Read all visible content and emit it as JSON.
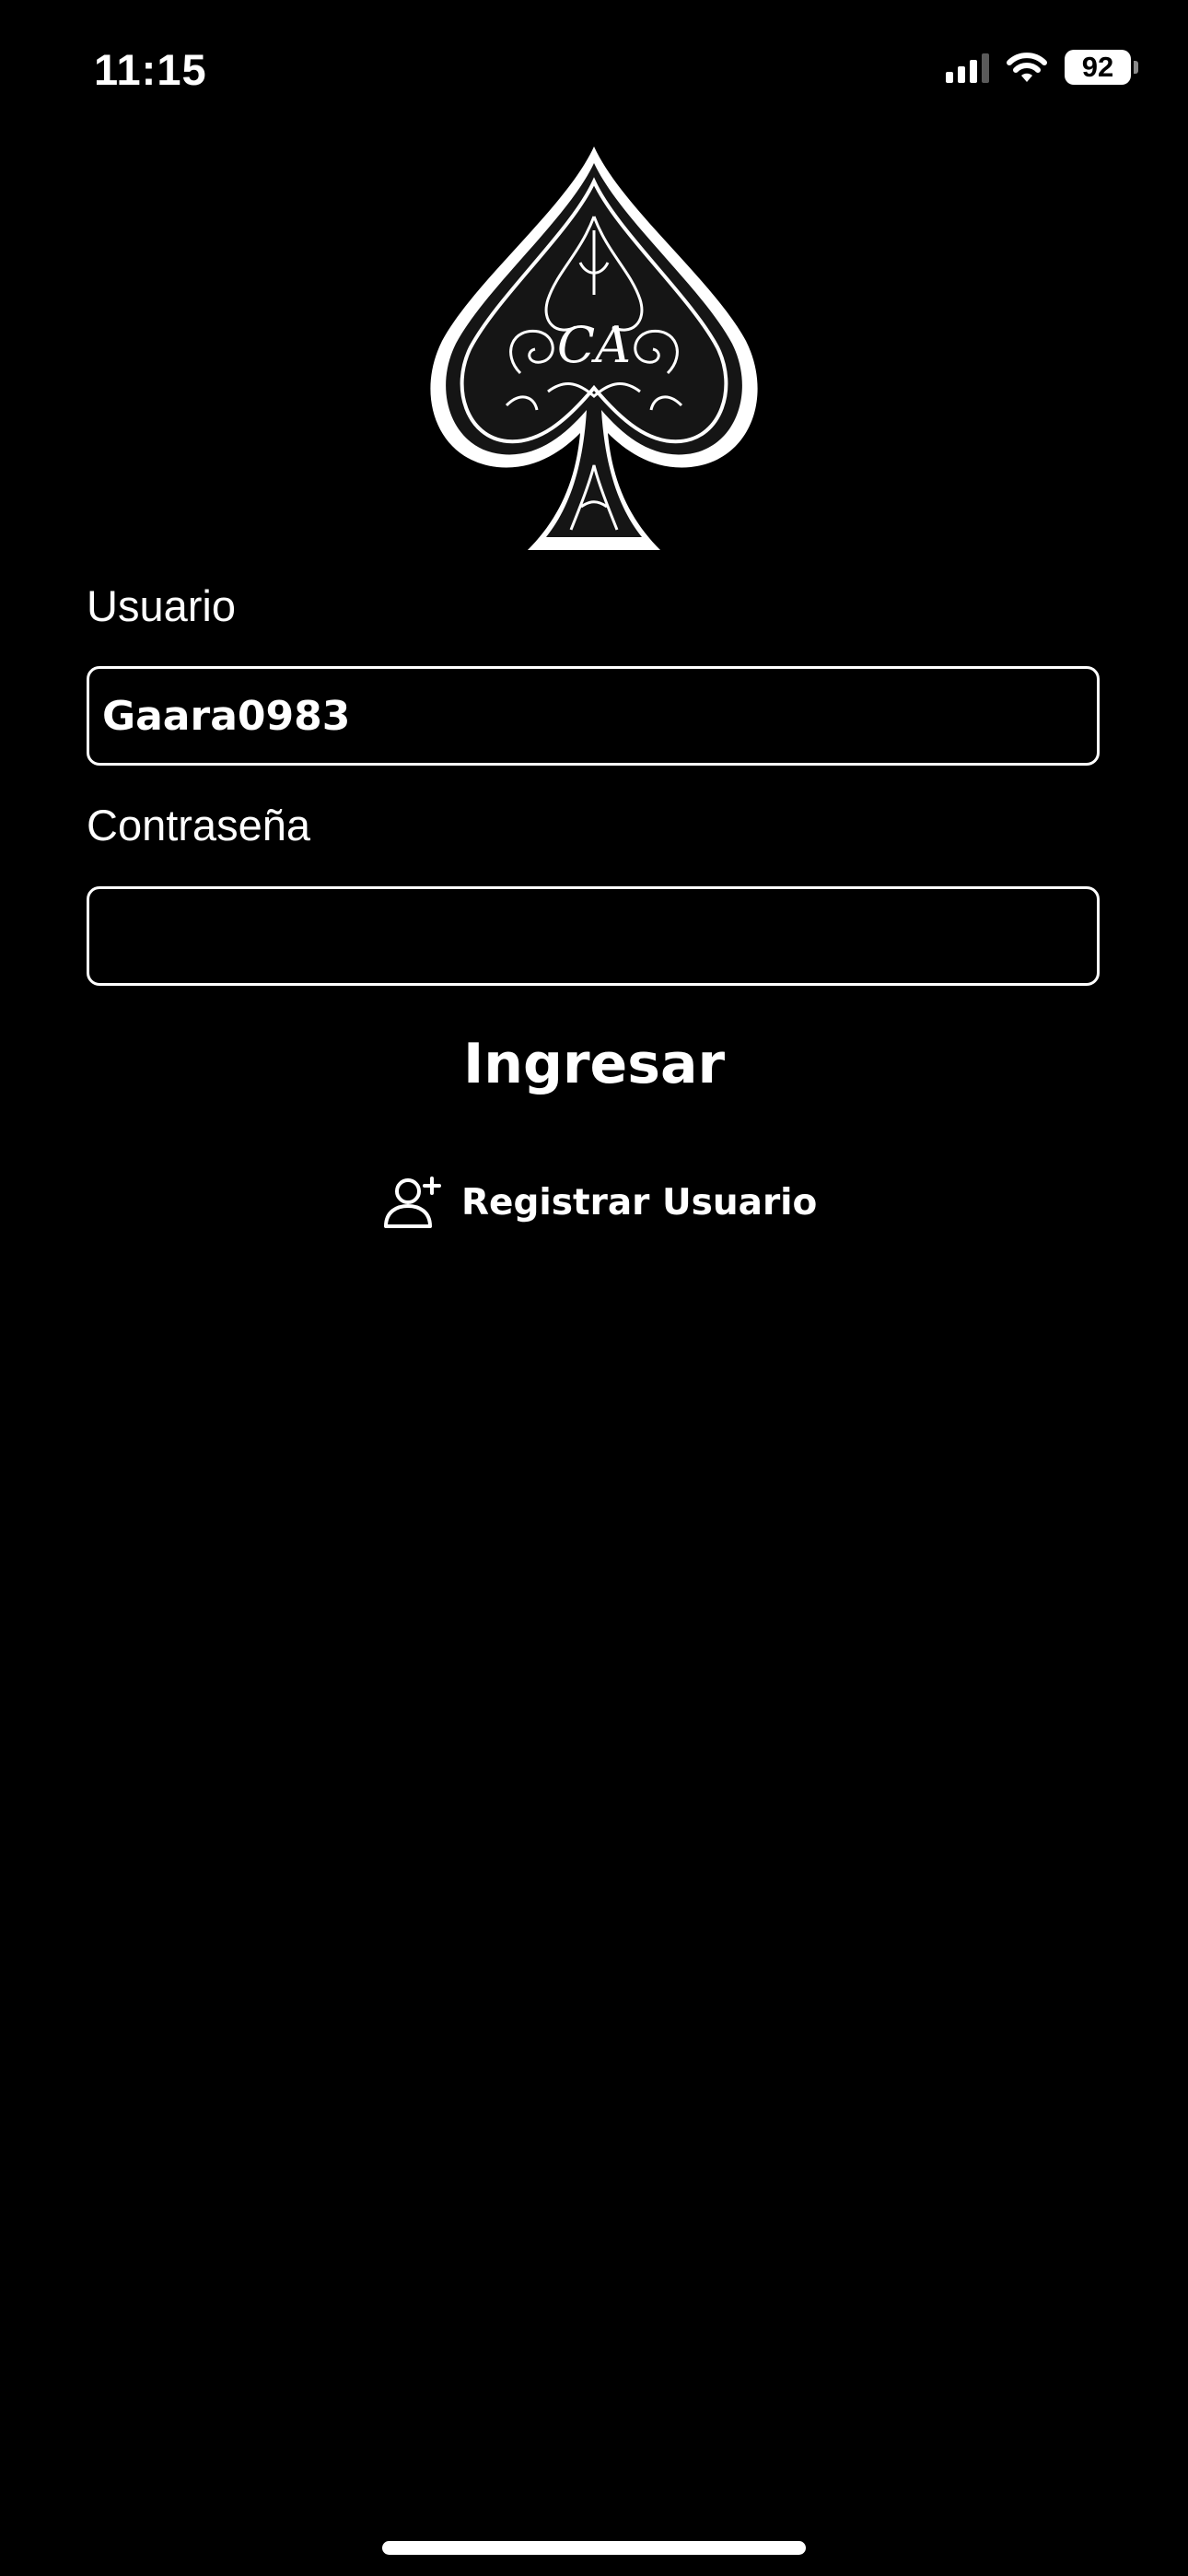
{
  "status_bar": {
    "time": "11:15",
    "battery": "92",
    "icons": [
      "signal-icon",
      "wifi-icon",
      "battery-icon"
    ]
  },
  "logo": {
    "name": "ace-of-spades-logo",
    "monogram": "CA"
  },
  "form": {
    "username_label": "Usuario",
    "username_value": "Gaara0983",
    "password_label": "Contraseña",
    "password_value": "",
    "login_button": "Ingresar"
  },
  "register": {
    "label": "Registrar Usuario",
    "icon": "add-user-icon"
  },
  "colors": {
    "background": "#000000",
    "foreground": "#ffffff"
  }
}
